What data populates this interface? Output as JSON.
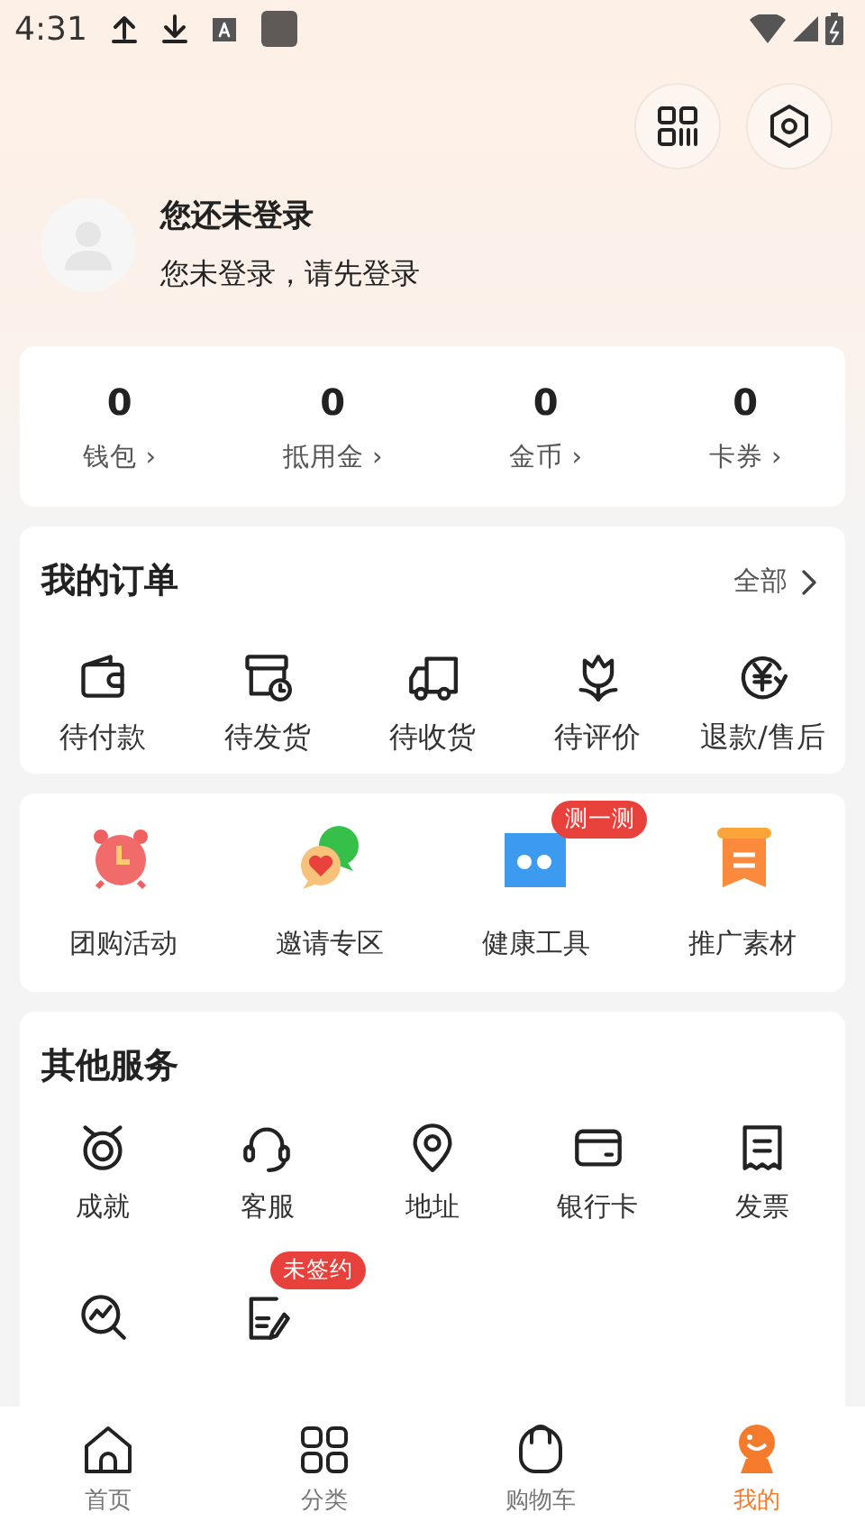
{
  "status_bar": {
    "time": "4:31"
  },
  "header": {
    "buttons": [
      {
        "kind": "qr"
      },
      {
        "kind": "settings"
      }
    ]
  },
  "profile": {
    "title": "您还未登录",
    "subtitle": "您未登录，请先登录"
  },
  "stats": [
    {
      "value": "0",
      "label": "钱包 ›"
    },
    {
      "value": "0",
      "label": "抵用金 ›"
    },
    {
      "value": "0",
      "label": "金币 ›"
    },
    {
      "value": "0",
      "label": "卡券 ›"
    }
  ],
  "orders": {
    "title": "我的订单",
    "more": "全部",
    "items": [
      {
        "kind": "wallet",
        "label": "待付款"
      },
      {
        "kind": "box",
        "label": "待发货"
      },
      {
        "kind": "truck",
        "label": "待收货"
      },
      {
        "kind": "flower",
        "label": "待评价"
      },
      {
        "kind": "refund",
        "label": "退款/售后"
      }
    ]
  },
  "tools": [
    {
      "kind": "alarm",
      "label": "团购活动"
    },
    {
      "kind": "chat",
      "label": "邀请专区"
    },
    {
      "kind": "scale",
      "label": "健康工具",
      "badge": "测一测"
    },
    {
      "kind": "scroll",
      "label": "推广素材"
    }
  ],
  "services": {
    "title": "其他服务",
    "items": [
      {
        "kind": "medal",
        "label": "成就"
      },
      {
        "kind": "headset",
        "label": "客服"
      },
      {
        "kind": "pin",
        "label": "地址"
      },
      {
        "kind": "card",
        "label": "银行卡"
      },
      {
        "kind": "invoice",
        "label": "发票"
      },
      {
        "kind": "chart-search"
      },
      {
        "kind": "contract",
        "badge": "未签约"
      }
    ]
  },
  "tab_bar": [
    {
      "kind": "home",
      "label": "首页",
      "selected": false
    },
    {
      "kind": "grid",
      "label": "分类",
      "selected": false
    },
    {
      "kind": "bag",
      "label": "购物车",
      "selected": false
    },
    {
      "kind": "me",
      "label": "我的",
      "selected": true
    }
  ]
}
